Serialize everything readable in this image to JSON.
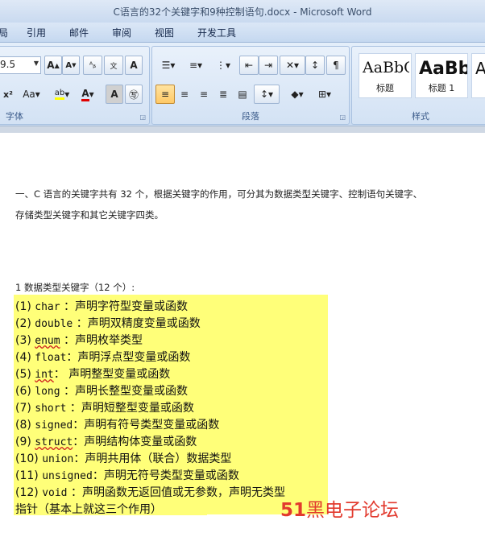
{
  "window": {
    "title": "C语言的32个关键字和9种控制语句.docx - Microsoft Word"
  },
  "menu": {
    "items": [
      "局",
      "引用",
      "邮件",
      "审阅",
      "视图",
      "开发工具"
    ]
  },
  "ribbon": {
    "font_group": {
      "label": "字体",
      "font_size": "9.5"
    },
    "paragraph_group": {
      "label": "段落"
    },
    "styles_group": {
      "label": "样式",
      "tiles": [
        {
          "preview": "AaBbC",
          "name": "标题"
        },
        {
          "preview": "AaBb",
          "name": "标题 1"
        },
        {
          "preview": "A",
          "name": ""
        }
      ]
    }
  },
  "doc": {
    "intro_line1": "一、C 语言的关键字共有 32 个，根据关键字的作用，可分其为数据类型关键字、控制语句关键字、",
    "intro_line2": "存储类型关键字和其它关键字四类。",
    "section_title": "1 数据类型关键字（12 个）:",
    "items": [
      {
        "num": "(1) ",
        "kw": "char",
        "desc": " ：声明字符型变量或函数"
      },
      {
        "num": "(2) ",
        "kw": "double",
        "desc": " ：声明双精度变量或函数"
      },
      {
        "num": "(3) ",
        "kw": "enum",
        "desc": " ：声明枚举类型"
      },
      {
        "num": "(4) ",
        "kw": "float",
        "desc": "：声明浮点型变量或函数"
      },
      {
        "num": "(5) ",
        "kw": "int",
        "desc": "：  声明整型变量或函数"
      },
      {
        "num": "(6) ",
        "kw": "long",
        "desc": " ：声明长整型变量或函数"
      },
      {
        "num": "(7) ",
        "kw": "short",
        "desc": " ：声明短整型变量或函数"
      },
      {
        "num": "(8) ",
        "kw": "signed",
        "desc": "：声明有符号类型变量或函数"
      },
      {
        "num": "(9) ",
        "kw": "struct",
        "desc": "：声明结构体变量或函数"
      },
      {
        "num": "(10) ",
        "kw": "union",
        "desc": "：声明共用体（联合）数据类型"
      },
      {
        "num": "(11) ",
        "kw": "unsigned",
        "desc": "：声明无符号类型变量或函数"
      },
      {
        "num": "(12) ",
        "kw": "void",
        "desc": " ：声明函数无返回值或无参数，声明无类型"
      }
    ],
    "trailing": "指针（基本上就这三个作用）"
  },
  "watermark": {
    "num": "51",
    "text": "黑电子论坛"
  }
}
